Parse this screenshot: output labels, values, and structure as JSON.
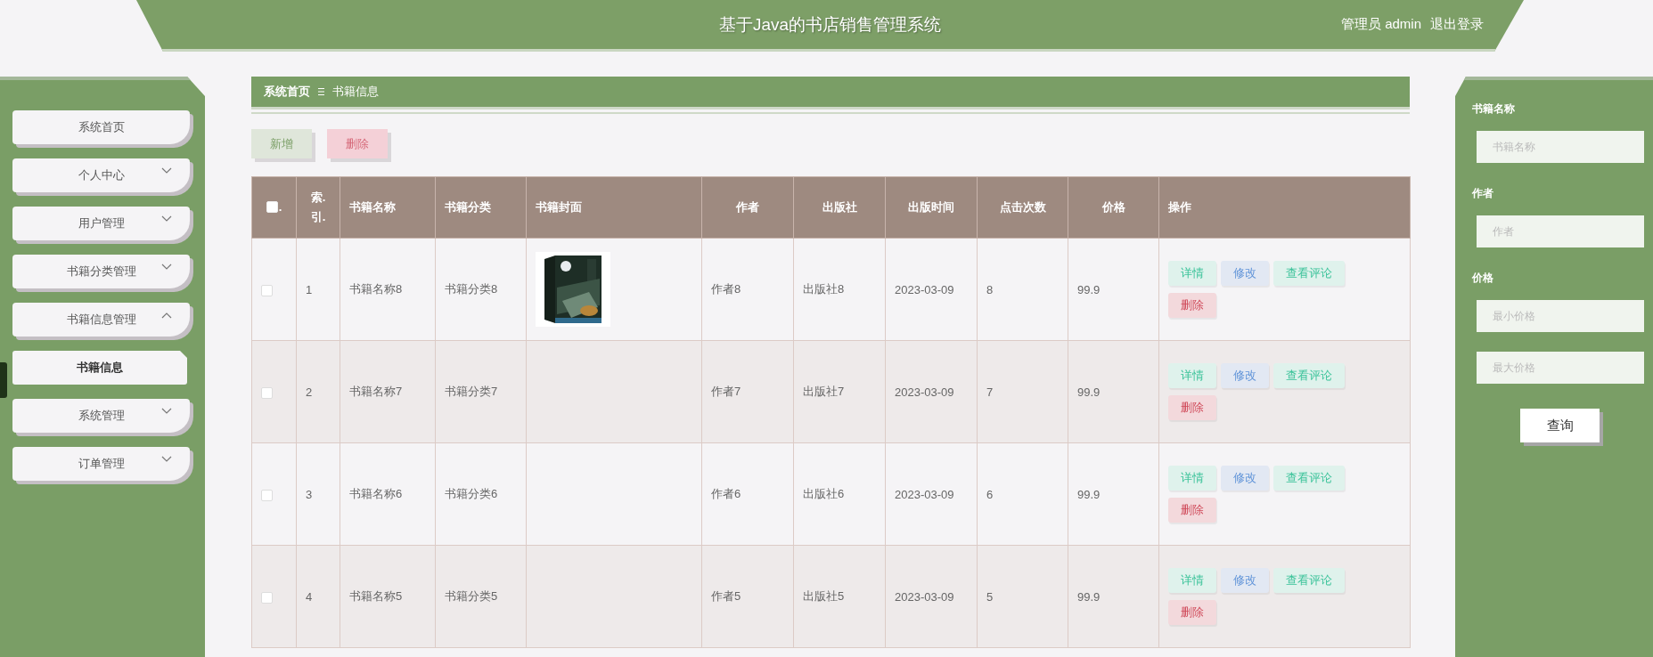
{
  "header": {
    "title": "基于Java的书店销售管理系统",
    "user": "管理员 admin",
    "logout": "退出登录"
  },
  "sidebar": {
    "items": [
      {
        "label": "系统首页",
        "kind": "link"
      },
      {
        "label": "个人中心",
        "kind": "menu",
        "expanded": false
      },
      {
        "label": "用户管理",
        "kind": "menu",
        "expanded": false
      },
      {
        "label": "书籍分类管理",
        "kind": "menu",
        "expanded": false
      },
      {
        "label": "书籍信息管理",
        "kind": "menu",
        "expanded": true,
        "children": [
          {
            "label": "书籍信息",
            "selected": true
          }
        ]
      },
      {
        "label": "系统管理",
        "kind": "menu",
        "expanded": false
      },
      {
        "label": "订单管理",
        "kind": "menu",
        "expanded": false
      }
    ]
  },
  "breadcrumb": [
    "系统首页",
    "书籍信息"
  ],
  "toolbar": [
    {
      "label": "新增",
      "kind": "add"
    },
    {
      "label": "删除",
      "kind": "delete"
    }
  ],
  "table": {
    "select_all": {
      "label": ".",
      "checked": false
    },
    "columns": [
      "索.引.",
      "书籍名称",
      "书籍分类",
      "书籍封面",
      "作者",
      "出版社",
      "出版时间",
      "点击次数",
      "价格",
      "操作"
    ],
    "rows": [
      {
        "checked": false,
        "index": "1",
        "name": "书籍名称8",
        "category": "书籍分类8",
        "author": "作者8",
        "publisher": "出版社8",
        "date": "2023-03-09",
        "clicks": "8",
        "price": "99.9",
        "actions": [
          {
            "label": "详情",
            "kind": "view"
          },
          {
            "label": "修改",
            "kind": "edit"
          },
          {
            "label": "查看评论",
            "kind": "comments"
          },
          {
            "label": "删除",
            "kind": "delete"
          }
        ]
      },
      {
        "checked": false,
        "index": "2",
        "name": "书籍名称7",
        "category": "书籍分类7",
        "author": "作者7",
        "publisher": "出版社7",
        "date": "2023-03-09",
        "clicks": "7",
        "price": "99.9",
        "actions": [
          {
            "label": "详情",
            "kind": "view"
          },
          {
            "label": "修改",
            "kind": "edit"
          },
          {
            "label": "查看评论",
            "kind": "comments"
          },
          {
            "label": "删除",
            "kind": "delete"
          }
        ]
      },
      {
        "checked": false,
        "index": "3",
        "name": "书籍名称6",
        "category": "书籍分类6",
        "author": "作者6",
        "publisher": "出版社6",
        "date": "2023-03-09",
        "clicks": "6",
        "price": "99.9",
        "actions": [
          {
            "label": "详情",
            "kind": "view"
          },
          {
            "label": "修改",
            "kind": "edit"
          },
          {
            "label": "查看评论",
            "kind": "comments"
          },
          {
            "label": "删除",
            "kind": "delete"
          }
        ]
      },
      {
        "checked": false,
        "index": "4",
        "name": "书籍名称5",
        "category": "书籍分类5",
        "author": "作者5",
        "publisher": "出版社5",
        "date": "2023-03-09",
        "clicks": "5",
        "price": "99.9",
        "actions": [
          {
            "label": "详情",
            "kind": "view"
          },
          {
            "label": "修改",
            "kind": "edit"
          },
          {
            "label": "查看评论",
            "kind": "comments"
          },
          {
            "label": "删除",
            "kind": "delete"
          }
        ]
      }
    ]
  },
  "search": {
    "fields": [
      {
        "label": "书籍名称",
        "inputs": [
          {
            "placeholder": "书籍名称"
          }
        ]
      },
      {
        "label": "作者",
        "inputs": [
          {
            "placeholder": "作者"
          }
        ]
      },
      {
        "label": "价格",
        "inputs": [
          {
            "placeholder": "最小价格"
          },
          {
            "placeholder": "最大价格"
          }
        ]
      }
    ],
    "button": "查询"
  }
}
